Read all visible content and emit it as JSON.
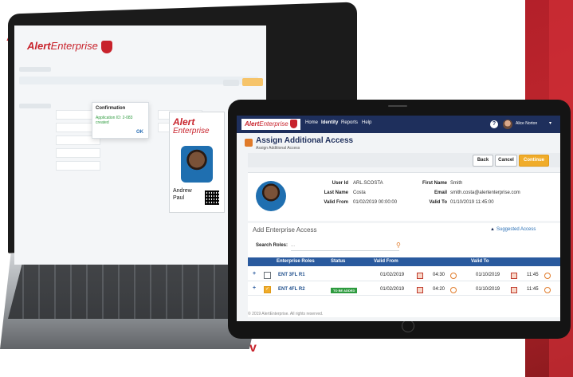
{
  "decor": {
    "caret_up": "^",
    "caret_down": "v",
    "accent": "#c8232c"
  },
  "laptop": {
    "logo": {
      "alert": "Alert",
      "enterprise": "Enterprise"
    },
    "confirmation": {
      "title": "Confirmation",
      "message": "Application ID: 2-083 created",
      "ok": "OK"
    },
    "badge": {
      "brand_alert": "Alert",
      "brand_enterprise": "Enterprise",
      "first_name": "Andrew",
      "last_name": "Paul"
    }
  },
  "tablet": {
    "nav": {
      "logo_alert": "Alert",
      "logo_enterprise": "Enterprise",
      "items": [
        "Home",
        "Identity",
        "Reports",
        "Help"
      ],
      "active": "Identity",
      "user_name": "Alice Norton",
      "help_icon": "question-icon",
      "colors": {
        "navbar": "#1e2f5c"
      }
    },
    "page": {
      "title": "Assign Additional Access",
      "subtitle": "Assign Additional Access"
    },
    "buttons": {
      "back": "Back",
      "cancel": "Cancel",
      "continue": "Continue"
    },
    "user": {
      "user_id_label": "User Id",
      "user_id": "ARL.SCOSTA",
      "last_name_label": "Last Name",
      "last_name": "Costa",
      "valid_from_label": "Valid From",
      "valid_from": "01/02/2019 00:00:00",
      "first_name_label": "First Name",
      "first_name": "Smith",
      "email_label": "Email",
      "email": "smith.costa@alertenterprise.com",
      "valid_to_label": "Valid To",
      "valid_to": "01/10/2019 11:45:00"
    },
    "access": {
      "section_title": "Add Enterprise Access",
      "suggested": "Suggested Access",
      "search_label": "Search Roles:",
      "search_value": "...",
      "columns": [
        "Enterprise Roles",
        "Status",
        "Valid From",
        "Valid To"
      ],
      "rows": [
        {
          "expand": "+",
          "checked": false,
          "role": "ENT 3FL R1",
          "status": "",
          "from_date": "01/02/2019",
          "from_time": "04:30",
          "to_date": "01/10/2019",
          "to_time": "11:45"
        },
        {
          "expand": "+",
          "checked": true,
          "role": "ENT 4FL R2",
          "status": "TO BE ADDED",
          "from_date": "01/02/2019",
          "from_time": "04:20",
          "to_date": "01/10/2019",
          "to_time": "11:45"
        }
      ]
    },
    "footer": "© 2019 AlertEnterprise. All rights reserved."
  }
}
